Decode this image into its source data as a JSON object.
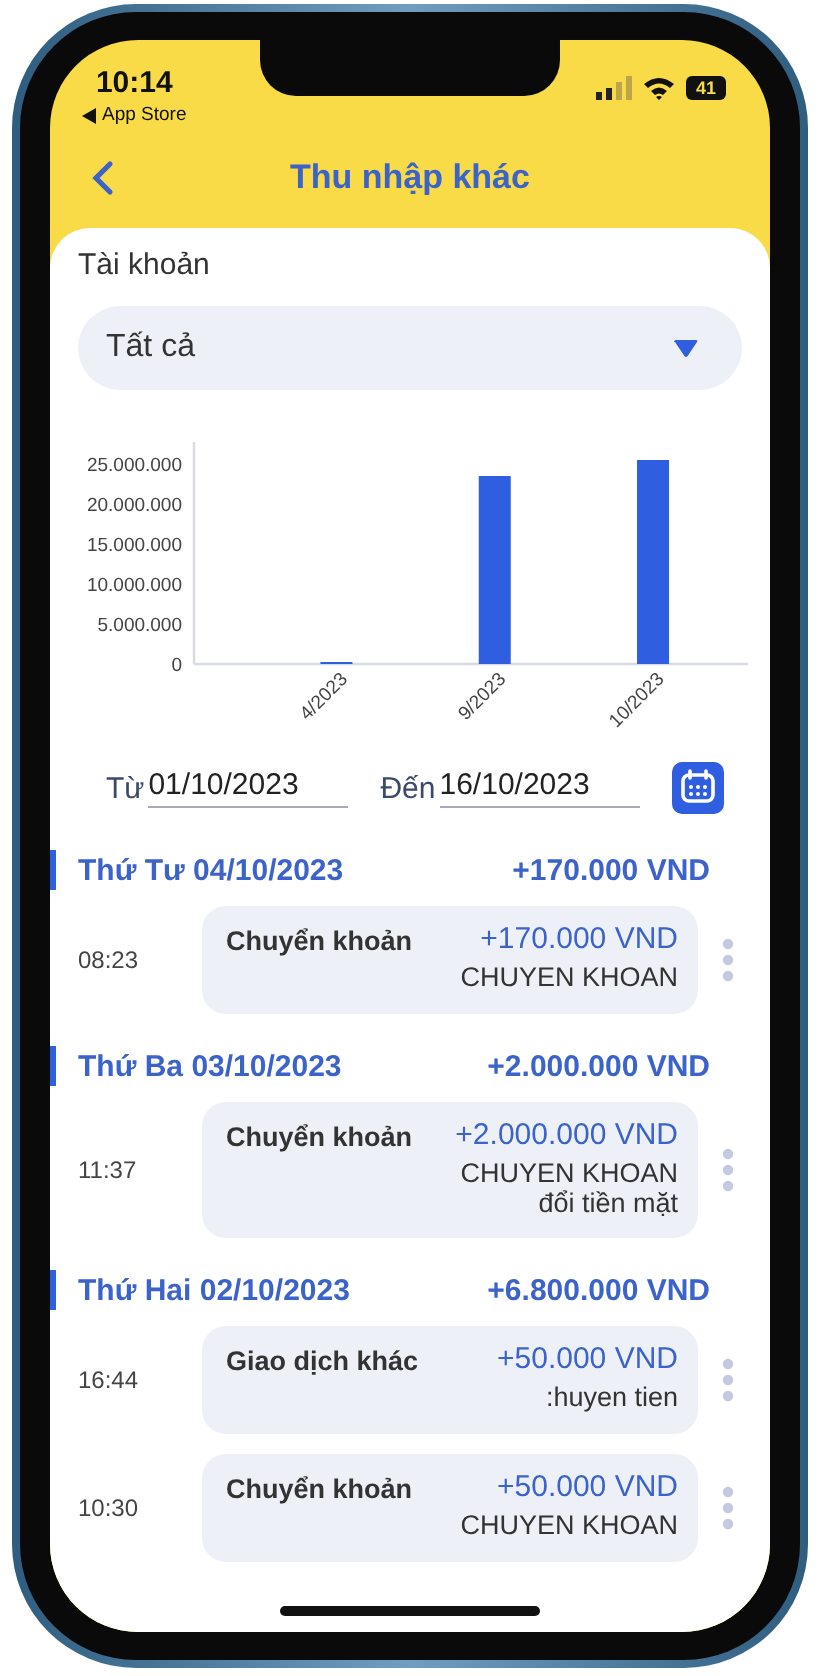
{
  "status_bar": {
    "time": "10:14",
    "back_to_app": "App Store",
    "battery": "41"
  },
  "header": {
    "title": "Thu nhập khác"
  },
  "account": {
    "label": "Tài khoản",
    "value": "Tất cả"
  },
  "chart_data": {
    "type": "bar",
    "categories": [
      "4/2023",
      "9/2023",
      "10/2023"
    ],
    "series": [
      {
        "color": "#2f5fe0",
        "values": [
          100000,
          23500000,
          25500000
        ]
      }
    ],
    "ylim": [
      0,
      27750000
    ],
    "yticks": [
      {
        "value": 0,
        "label": "0"
      },
      {
        "value": 5000000,
        "label": "5.000.000"
      },
      {
        "value": 10000000,
        "label": "10.000.000"
      },
      {
        "value": 15000000,
        "label": "15.000.000"
      },
      {
        "value": 20000000,
        "label": "20.000.000"
      },
      {
        "value": 25000000,
        "label": "25.000.000"
      }
    ]
  },
  "date_range": {
    "from_label": "Từ",
    "from": "01/10/2023",
    "to_label": "Đến",
    "to": "16/10/2023"
  },
  "groups": [
    {
      "day": "Thứ Tư 04/10/2023",
      "total": "+170.000 VND",
      "transactions": [
        {
          "time": "08:23",
          "category": "Chuyển khoản",
          "amount": "+170.000 VND",
          "note": "CHUYEN KHOAN"
        }
      ]
    },
    {
      "day": "Thứ Ba 03/10/2023",
      "total": "+2.000.000 VND",
      "transactions": [
        {
          "time": "11:37",
          "category": "Chuyển khoản",
          "amount": "+2.000.000 VND",
          "note": "CHUYEN KHOAN đổi tiền mặt"
        }
      ]
    },
    {
      "day": "Thứ Hai 02/10/2023",
      "total": "+6.800.000 VND",
      "transactions": [
        {
          "time": "16:44",
          "category": "Giao dịch khác",
          "amount": "+50.000 VND",
          "note": ":huyen tien"
        },
        {
          "time": "10:30",
          "category": "Chuyển khoản",
          "amount": "+50.000 VND",
          "note": "CHUYEN KHOAN"
        }
      ]
    }
  ]
}
